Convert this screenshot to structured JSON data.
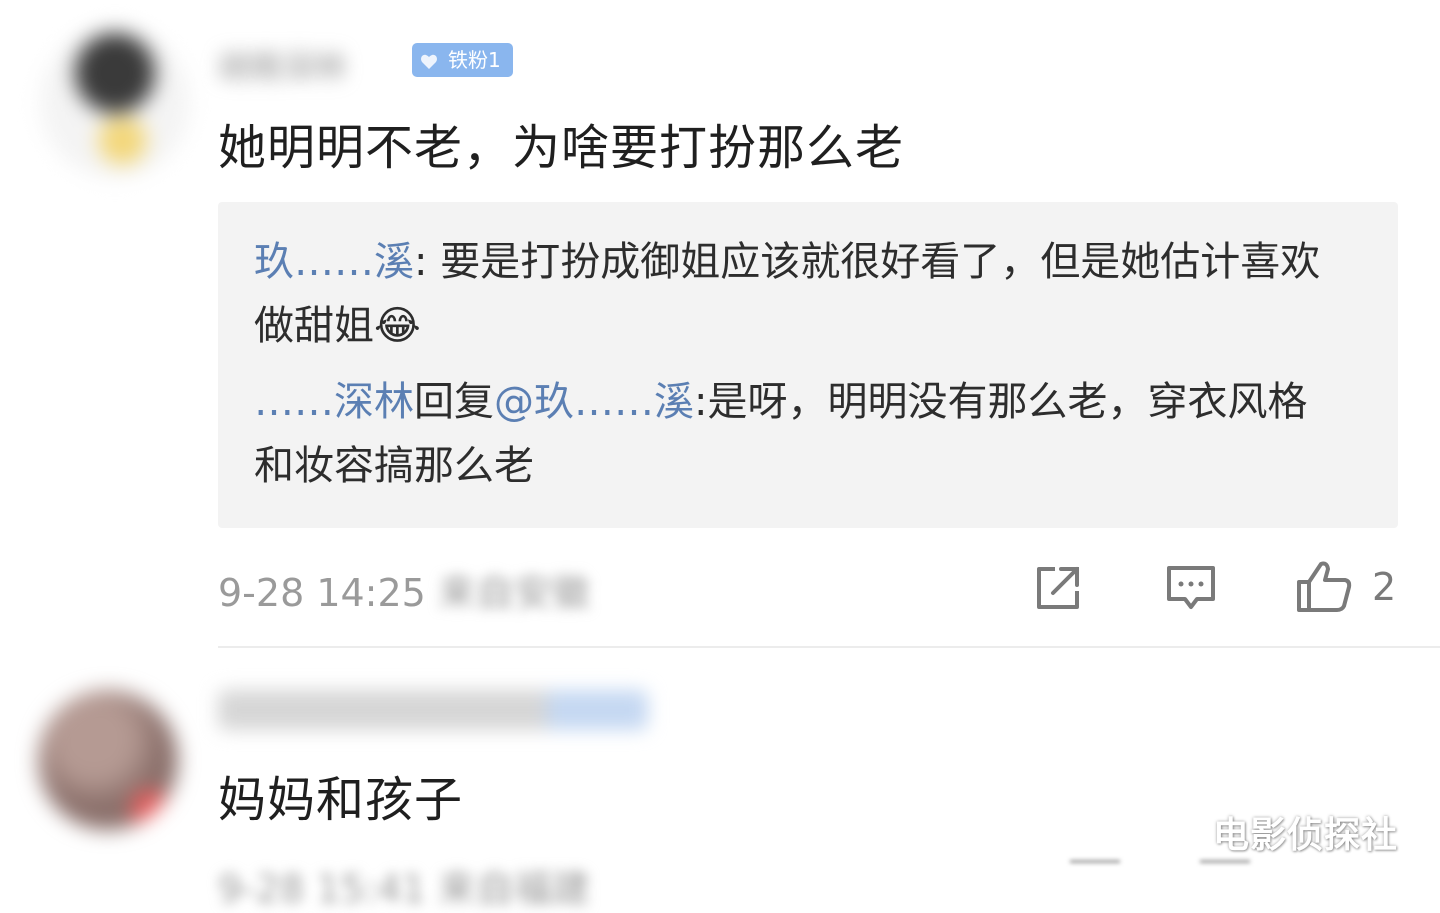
{
  "comments": [
    {
      "author": "胡南深林",
      "badge": "铁粉1",
      "text": "她明明不老，为啥要打扮那么老",
      "replies": [
        {
          "user": "玖……溪",
          "sep": ": ",
          "text": "要是打扮成御姐应该就很好看了，但是她估计喜欢做甜姐😂"
        },
        {
          "user": "……深林",
          "reply_word": "回复",
          "mention": "@玖……溪",
          "sep": ":",
          "text": "是呀，明明没有那么老，穿衣风格和妆容搞那么老"
        }
      ],
      "time": "9-28 14:25",
      "location": "来自安徽",
      "likes": "2"
    },
    {
      "author": "",
      "text": "妈妈和孩子",
      "time": "9-28 15:41",
      "location": "来自福建"
    }
  ],
  "watermark": "电影侦探社",
  "icons": [
    "share-icon",
    "comment-icon",
    "like-icon"
  ],
  "colors": {
    "username": "#5b7fb3",
    "badge": "#8ab6ee",
    "reply_bg": "#f3f3f3",
    "meta": "#9a9a9a"
  }
}
